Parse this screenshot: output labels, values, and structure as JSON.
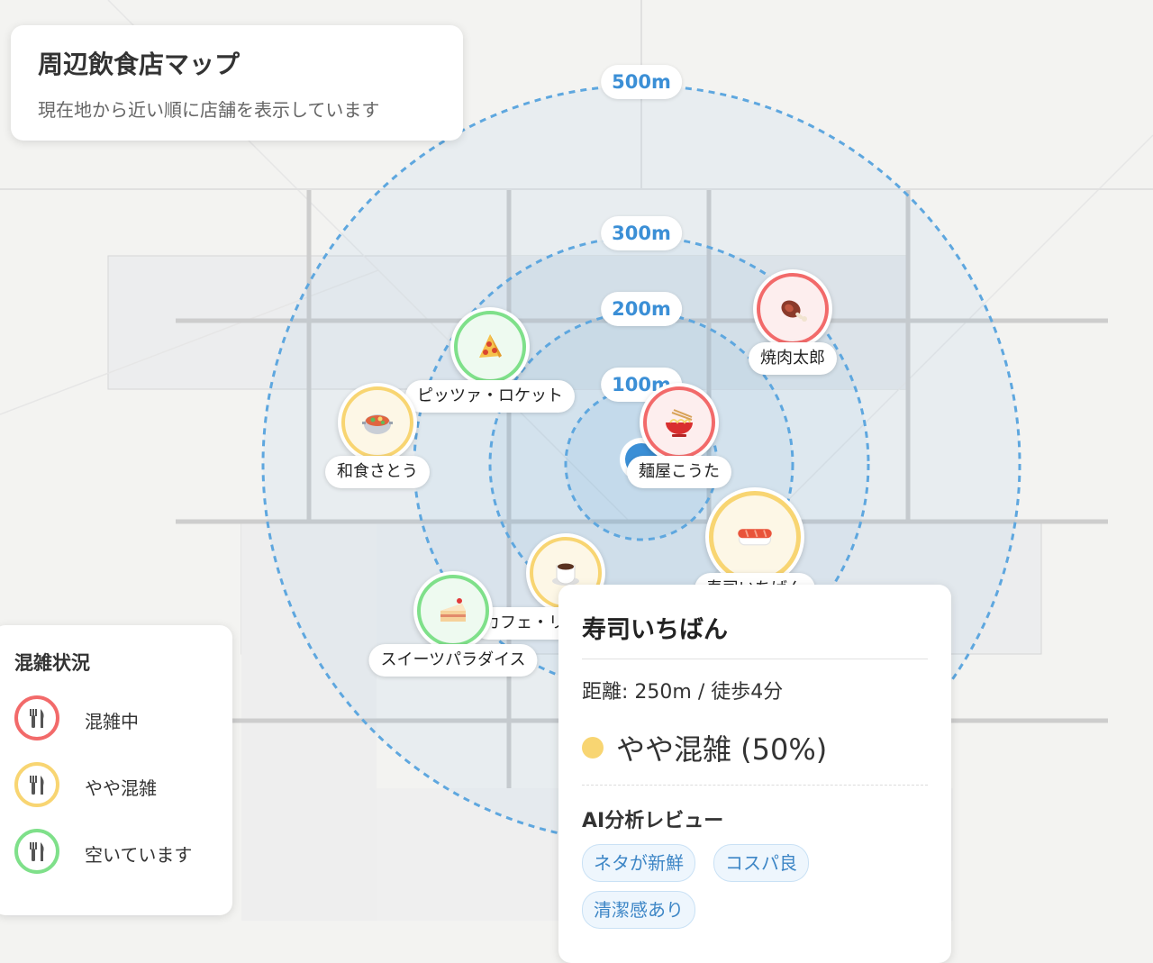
{
  "header": {
    "title": "周辺飲食店マップ",
    "subtitle": "現在地から近い順に店舗を表示しています"
  },
  "rings": [
    {
      "label": "500m"
    },
    {
      "label": "300m"
    },
    {
      "label": "200m"
    },
    {
      "label": "100m"
    }
  ],
  "colors": {
    "busy": "#f26a6a",
    "moderate": "#f8d572",
    "available": "#7fe08a",
    "ring": "#5ea7df",
    "accent": "#3b8fd6"
  },
  "restaurants": [
    {
      "name": "焼肉太郎",
      "icon": "meat-icon",
      "status": "busy"
    },
    {
      "name": "ピッツァ・ロケット",
      "icon": "pizza-icon",
      "status": "available"
    },
    {
      "name": "和食さとう",
      "icon": "hotpot-icon",
      "status": "moderate"
    },
    {
      "name": "麺屋こうた",
      "icon": "ramen-icon",
      "status": "busy"
    },
    {
      "name": "寿司いちばん",
      "icon": "sushi-icon",
      "status": "moderate"
    },
    {
      "name": "カフェ・リ",
      "icon": "coffee-icon",
      "status": "moderate"
    },
    {
      "name": "スイーツパラダイス",
      "icon": "cake-icon",
      "status": "available"
    }
  ],
  "legend": {
    "title": "混雑状況",
    "items": [
      {
        "label": "混雑中",
        "status": "busy",
        "icon": "utensils-icon"
      },
      {
        "label": "やや混雑",
        "status": "moderate",
        "icon": "utensils-icon"
      },
      {
        "label": "空いています",
        "status": "available",
        "icon": "utensils-icon"
      }
    ]
  },
  "popup": {
    "name": "寿司いちばん",
    "distance": "距離: 250m / 徒歩4分",
    "crowd": "やや混雑 (50%)",
    "crowd_level_percent": 50,
    "review_title": "AI分析レビュー",
    "tags": [
      "ネタが新鮮",
      "コスパ良",
      "清潔感あり"
    ]
  }
}
